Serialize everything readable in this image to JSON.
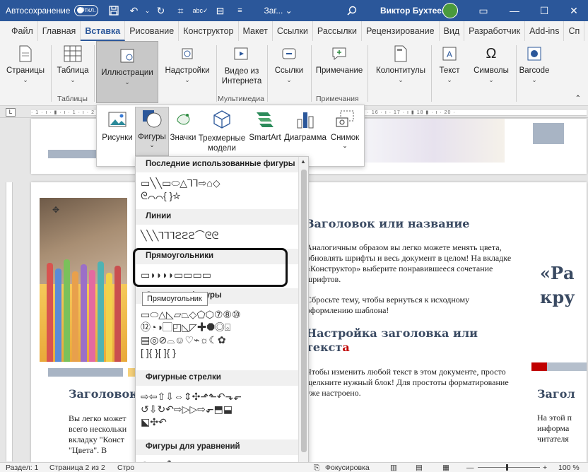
{
  "titlebar": {
    "autosave_label": "Автосохранение",
    "autosave_state": "Откл.",
    "doc_name": "Заг... ⌄",
    "user_name": "Виктор Бухтеев",
    "accent_color": "#2b579a"
  },
  "tabs": [
    "Файл",
    "Главная",
    "Вставка",
    "Рисование",
    "Конструктор",
    "Макет",
    "Ссылки",
    "Рассылки",
    "Рецензирование",
    "Вид",
    "Разработчик",
    "Add-ins",
    "Сп"
  ],
  "active_tab": "Вставка",
  "ribbon": {
    "pages": "Страницы",
    "table": "Таблица",
    "illustrations": "Иллюстрации",
    "addins": "Надстройки",
    "online_video": "Видео из Интернета",
    "links": "Ссылки",
    "comment": "Примечание",
    "header_footer": "Колонтитулы",
    "text": "Текст",
    "symbols": "Символы",
    "barcode": "Barcode",
    "group_tables": "Таблицы",
    "group_media": "Мультимедиа",
    "group_comments": "Примечания"
  },
  "illustrations_menu": {
    "pictures": "Рисунки",
    "shapes": "Фигуры",
    "icons": "Значки",
    "models_3d": "Трехмерные модели",
    "smartart": "SmartArt",
    "chart": "Диаграмма",
    "screenshot": "Снимок"
  },
  "shapes_gallery": {
    "sections": [
      {
        "title": "Последние использованные фигуры",
        "rows": [
          "▭╲╲▭⬭△⅂⅂⇨⌂◇",
          "ᘓ⌒⌒{ }☆"
        ]
      },
      {
        "title": "Линии",
        "rows": [
          "╲╲╲⅂⅂⅂ϩϩϩ⌒ᘓᘓ"
        ]
      },
      {
        "title": "Прямоугольники",
        "rows": [
          "▭◗◗◗◗▭▭▭▭"
        ]
      },
      {
        "title": "Основные фигуры",
        "rows": [
          "▭⬭△◺▱⏢◇⬠⬡⑦⑧⑩",
          "⑫◔◑▢◰◺◸✚⯃◎⌺",
          "▤◎⊘⌓☺♡⌁☼☾✿",
          "[ ]{ }[ ]{ }"
        ]
      },
      {
        "title": "Фигурные стрелки",
        "rows": [
          "⇨⇦⇧⇩⇔⇕✣⬏⬑↶⬎⬐",
          "↺⇩↻↶⇨▷▷⇨⬐⬒⬓",
          "⬕✣↶"
        ]
      },
      {
        "title": "Фигуры для уравнений",
        "rows": [
          "✚━✖➗═≠"
        ]
      }
    ],
    "tooltip": "Прямоугольник"
  },
  "document": {
    "heading1": "Заголовок или название",
    "para1": "Аналогичным образом вы легко можете менять цвета, обновлять шрифты и весь документ в целом! На вкладке «Конструктор» выберите понравившееся сочетание шрифтов.",
    "para2": "Сбросьте тему, чтобы вернуться к исходному оформлению шаблона!",
    "heading2_part1": "Настройка заголовка или текст",
    "heading2_part2": "а",
    "para3": "Чтобы изменить любой текст в этом документе, просто щелкните нужный блок! Для простоты форматирование уже настроено.",
    "left_heading": "Заголовок",
    "left_para": "Вы легко может всего нескольки вкладку \"Конст \"Цвета\". В",
    "right_big": "«Ра кру",
    "right_heading": "Загол",
    "right_para": "На этой п информа читателя",
    "red_color": "#c00000"
  },
  "statusbar": {
    "section": "Раздел: 1",
    "page": "Страница 2 из 2",
    "words": "Стро",
    "focus": "Фокусировка",
    "zoom": "100 %"
  }
}
